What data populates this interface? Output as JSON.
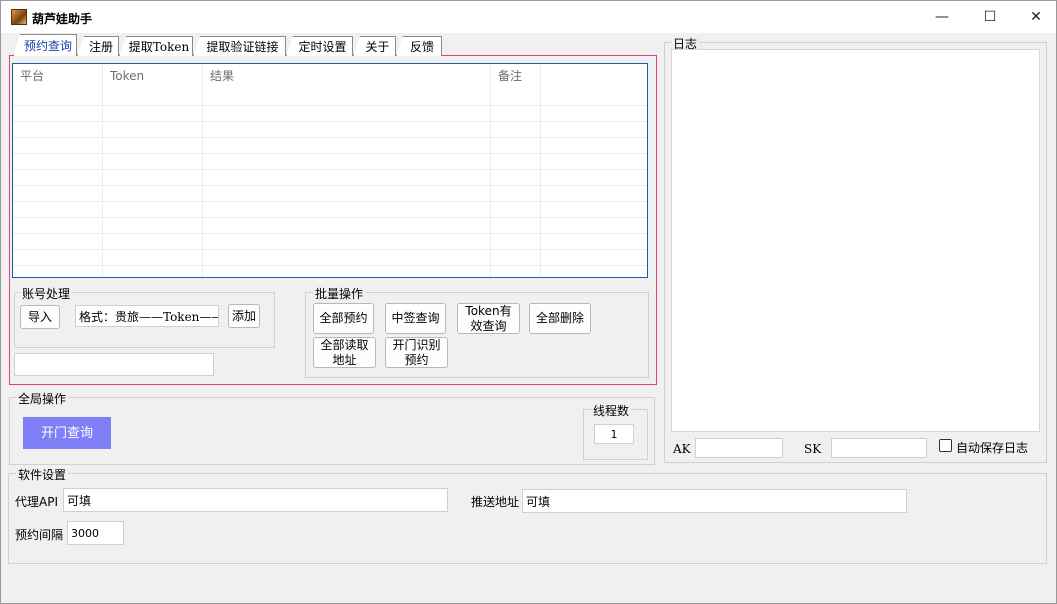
{
  "window": {
    "title": "葫芦娃助手",
    "icon": "gourd-app-icon",
    "controls": {
      "minimize": "—",
      "maximize": "☐",
      "close": "✕"
    }
  },
  "tabs": [
    {
      "label": "预约查询",
      "active": true
    },
    {
      "label": "注册",
      "active": false
    },
    {
      "label": "提取Token",
      "active": false
    },
    {
      "label": "提取验证链接",
      "active": false
    },
    {
      "label": "定时设置",
      "active": false
    },
    {
      "label": "关于",
      "active": false
    },
    {
      "label": "反馈",
      "active": false
    }
  ],
  "table": {
    "columns": [
      "平台",
      "Token",
      "结果",
      "备注",
      ""
    ],
    "rows": []
  },
  "account": {
    "group_label": "账号处理",
    "import_button": "导入",
    "format_input": "格式：贵旅——Token——",
    "add_button": "添加",
    "extra_input": ""
  },
  "batch": {
    "group_label": "批量操作",
    "buttons": [
      "全部预约",
      "中签查询",
      "Token有效查询",
      "全部删除",
      "全部读取地址",
      "开门识别预约"
    ]
  },
  "global": {
    "group_label": "全局操作",
    "open_query_button": "开门查询",
    "threads_label": "线程数",
    "threads_value": "1"
  },
  "log": {
    "group_label": "日志",
    "ak_label": "AK",
    "ak_value": "",
    "sk_label": "SK",
    "sk_value": "",
    "autosave_label": "自动保存日志",
    "autosave_checked": false
  },
  "settings": {
    "group_label": "软件设置",
    "proxy_label": "代理API",
    "proxy_value": "可填",
    "push_label": "推送地址",
    "push_value": "可填",
    "interval_label": "预约间隔",
    "interval_value": "3000"
  },
  "colors": {
    "accent_pink": "#e0407a",
    "grid_border": "#1e5ea8",
    "primary_button": "#7f7ff7",
    "active_tab_text": "#1a3fb0"
  }
}
